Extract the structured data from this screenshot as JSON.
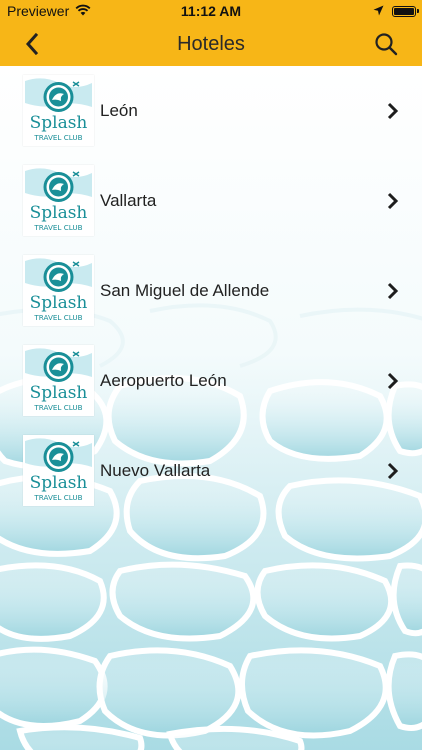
{
  "status_bar": {
    "carrier": "Previewer",
    "time": "11:12 AM"
  },
  "nav": {
    "title": "Hoteles"
  },
  "logo": {
    "brand": "Splash",
    "tagline": "TRAVEL CLUB"
  },
  "hotels": [
    {
      "name": "León"
    },
    {
      "name": "Vallarta"
    },
    {
      "name": "San Miguel de Allende"
    },
    {
      "name": "Aeropuerto León"
    },
    {
      "name": "Nuevo Vallarta"
    }
  ],
  "colors": {
    "header": "#f7b617",
    "logo_teal": "#1a8f98",
    "water": "#bfe3ea"
  },
  "icons": {
    "back": "chevron-left-icon",
    "search": "search-icon",
    "row_chevron": "chevron-right-icon"
  }
}
